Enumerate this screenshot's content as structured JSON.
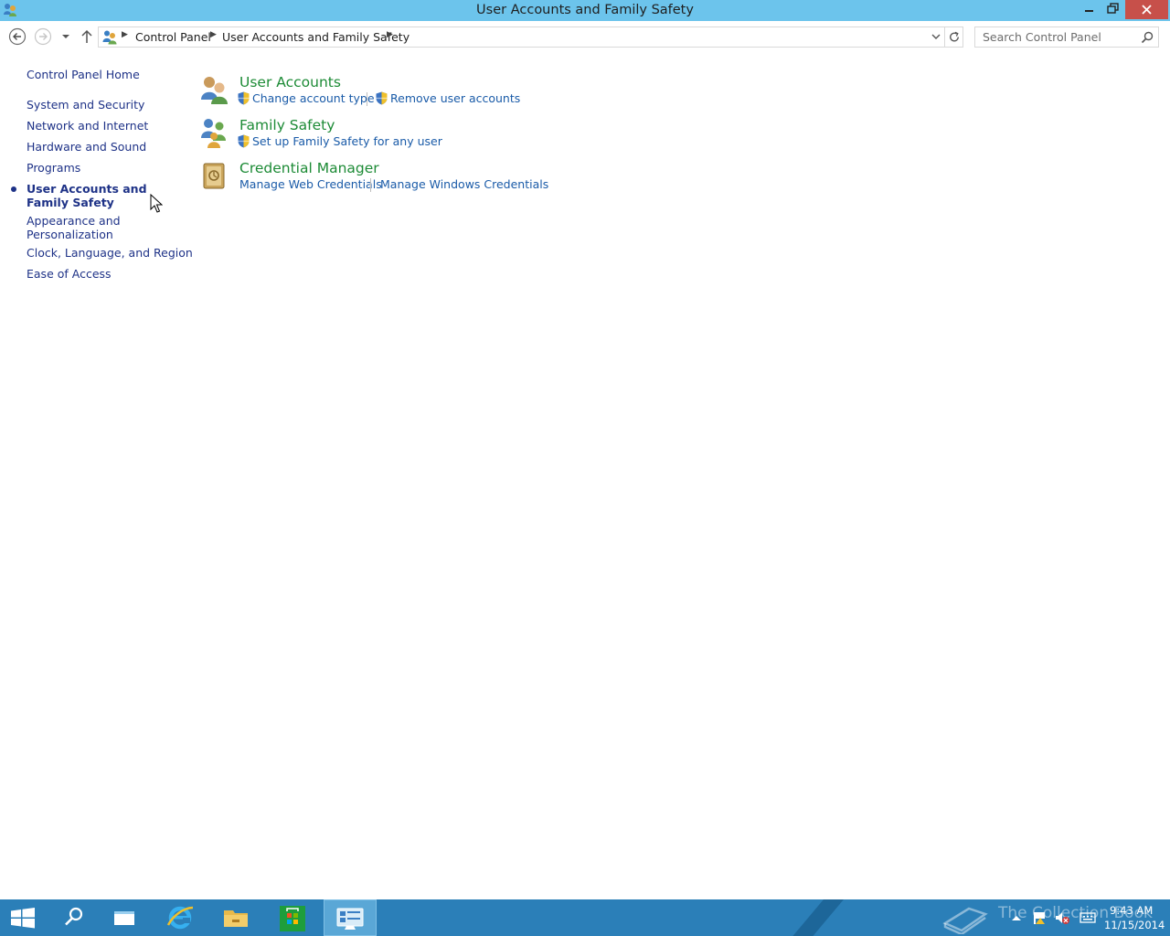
{
  "window": {
    "title": "User Accounts and Family Safety"
  },
  "address_bar": {
    "breadcrumb": [
      "Control Panel",
      "User Accounts and Family Safety"
    ],
    "search_placeholder": "Search Control Panel"
  },
  "left_nav": {
    "home": "Control Panel Home",
    "items": [
      "System and Security",
      "Network and Internet",
      "Hardware and Sound",
      "Programs",
      "User Accounts and Family Safety",
      "Appearance and Personalization",
      "Clock, Language, and Region",
      "Ease of Access"
    ],
    "current_item": "User Accounts and Family Safety"
  },
  "categories": [
    {
      "title": "User Accounts",
      "icon": "user-accounts-icon",
      "tasks": [
        "Change account type",
        "Remove user accounts"
      ]
    },
    {
      "title": "Family Safety",
      "icon": "family-safety-icon",
      "tasks": [
        "Set up Family Safety for any user"
      ]
    },
    {
      "title": "Credential Manager",
      "icon": "credential-manager-icon",
      "tasks": [
        "Manage Web Credentials",
        "Manage Windows Credentials"
      ]
    }
  ],
  "taskbar": {
    "items": [
      "start-icon",
      "search-icon",
      "task-view-icon",
      "internet-explorer-icon",
      "file-explorer-icon",
      "store-icon",
      "control-panel-icon"
    ],
    "active_item": "control-panel-icon",
    "watermark": "The Collection Book",
    "clock_time": "9:43 AM",
    "clock_date": "11/15/2014"
  },
  "colors": {
    "titlebar": "#6cc4ec",
    "close_button": "#c7504a",
    "category_heading": "#1d8b36",
    "task_link": "#1a5ba8",
    "nav_link": "#1e3287",
    "taskbar": "#2b7fb8"
  }
}
